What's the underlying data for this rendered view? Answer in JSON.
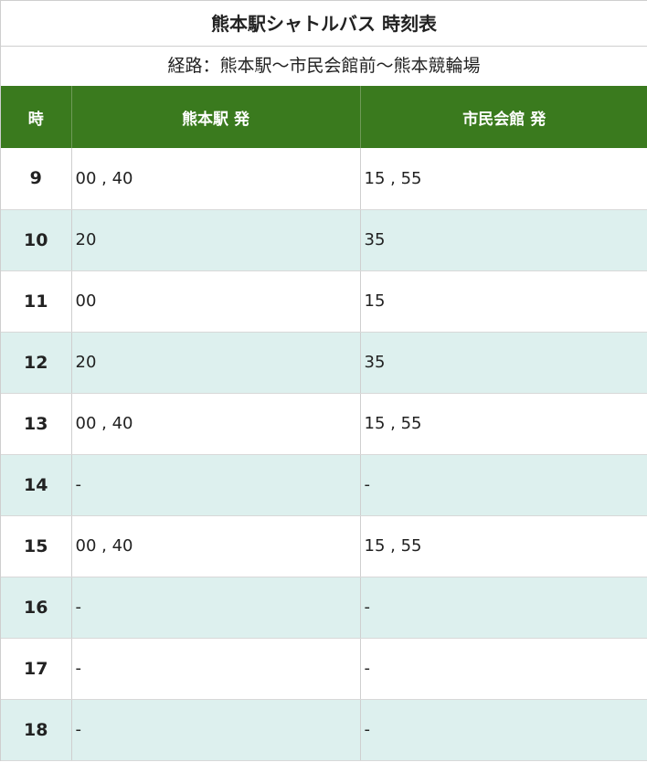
{
  "title": "熊本駅シャトルバス 時刻表",
  "route": "経路：熊本駅〜市民会館前〜熊本競輪場",
  "headers": {
    "hour": "時",
    "from_station": "熊本駅 発",
    "from_hall": "市民会館 発"
  },
  "colors": {
    "header_bg": "#3a7a1e",
    "stripe_bg": "#ddf0ee"
  },
  "rows": [
    {
      "hour": "9",
      "station": "00 , 40",
      "hall": "15 , 55"
    },
    {
      "hour": "10",
      "station": "20",
      "hall": "35"
    },
    {
      "hour": "11",
      "station": "00",
      "hall": "15"
    },
    {
      "hour": "12",
      "station": "20",
      "hall": "35"
    },
    {
      "hour": "13",
      "station": "00 , 40",
      "hall": "15 , 55"
    },
    {
      "hour": "14",
      "station": "-",
      "hall": "-"
    },
    {
      "hour": "15",
      "station": "00 , 40",
      "hall": "15 , 55"
    },
    {
      "hour": "16",
      "station": "-",
      "hall": "-"
    },
    {
      "hour": "17",
      "station": "-",
      "hall": "-"
    },
    {
      "hour": "18",
      "station": "-",
      "hall": "-"
    }
  ]
}
